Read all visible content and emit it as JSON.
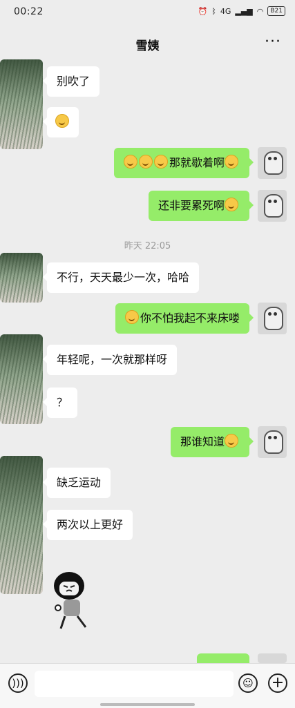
{
  "status": {
    "time": "00:22",
    "network": "4G",
    "battery": "B21"
  },
  "title": "雪姨",
  "more_icon": "more-dots-icon",
  "messages": {
    "m1": "别吹了",
    "m3": "那就歇着啊",
    "m4": "还非要累死啊",
    "timestamp": "昨天 22:05",
    "m5": "不行，天天最少一次，哈哈",
    "m6": "你不怕我起不来床喽",
    "m7": "年轻呢，一次就那样呀",
    "m8": "？",
    "m9": "那谁知道",
    "m10": "缺乏运动",
    "m11": "两次以上更好"
  },
  "input": {
    "placeholder": ""
  },
  "colors": {
    "accent_bubble": "#95ec69",
    "background": "#ededed"
  },
  "icons": {
    "voice": "voice-icon",
    "emoji": "emoji-icon",
    "plus": "plus-icon"
  }
}
